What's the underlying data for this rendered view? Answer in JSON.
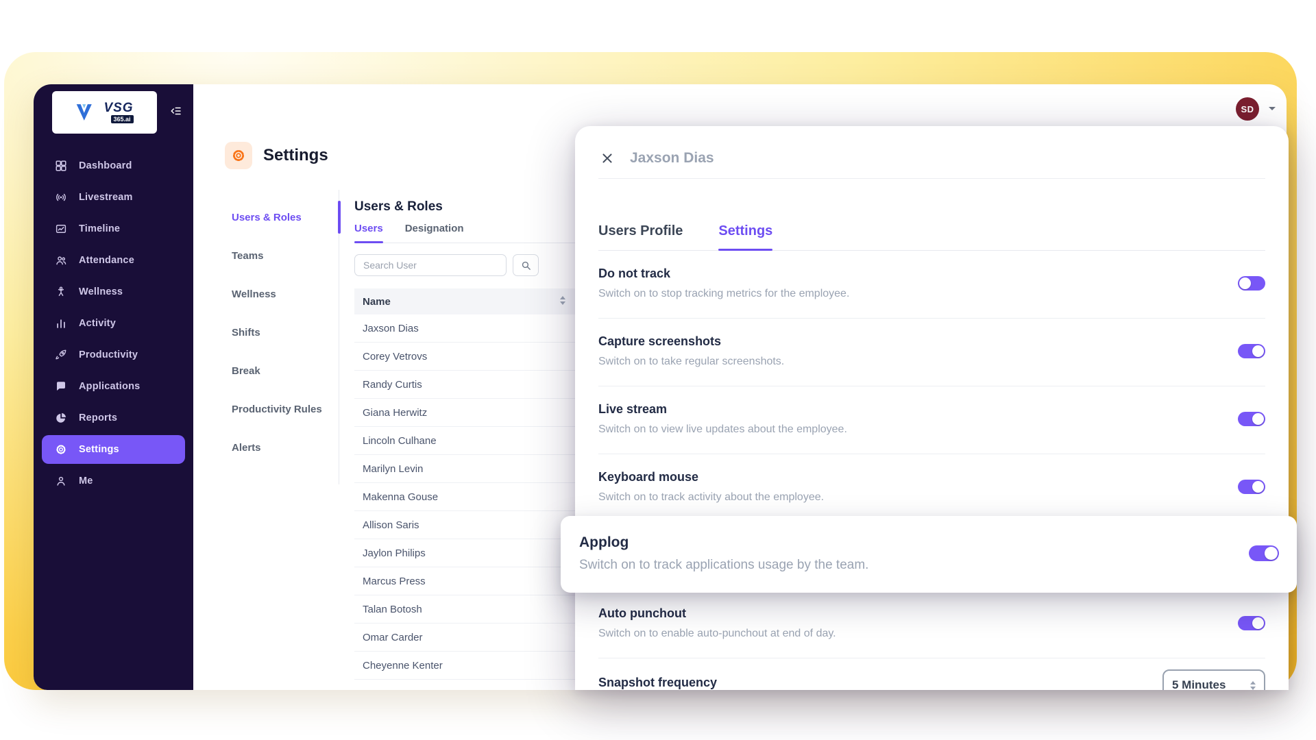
{
  "app": {
    "logo": {
      "brand": "VSG",
      "suffix": "365.ai"
    },
    "user": {
      "initials": "SD"
    }
  },
  "sidebar": {
    "items": [
      "Dashboard",
      "Livestream",
      "Timeline",
      "Attendance",
      "Wellness",
      "Activity",
      "Productivity",
      "Applications",
      "Reports",
      "Settings",
      "Me"
    ],
    "active": "Settings"
  },
  "page": {
    "title": "Settings"
  },
  "settings_nav": {
    "items": [
      "Users & Roles",
      "Teams",
      "Wellness",
      "Shifts",
      "Break",
      "Productivity Rules",
      "Alerts"
    ],
    "active": "Users & Roles"
  },
  "users_panel": {
    "heading": "Users & Roles",
    "tabs": [
      "Users",
      "Designation"
    ],
    "active_tab": "Users",
    "search_placeholder": "Search User",
    "table": {
      "name_column": "Name",
      "rows": [
        "Jaxson Dias",
        "Corey Vetrovs",
        "Randy Curtis",
        "Giana Herwitz",
        "Lincoln Culhane",
        "Marilyn Levin",
        "Makenna Gouse",
        "Allison Saris",
        "Jaylon Philips",
        "Marcus Press",
        "Talan Botosh",
        "Omar Carder",
        "Cheyenne Kenter"
      ]
    }
  },
  "drawer": {
    "title": "Jaxson Dias",
    "tabs": [
      "Users Profile",
      "Settings"
    ],
    "active_tab": "Settings",
    "settings": [
      {
        "title": "Do not track",
        "subtitle": "Switch on to stop tracking metrics for the employee.",
        "state": "off"
      },
      {
        "title": "Capture screenshots",
        "subtitle": "Switch on to take regular screenshots.",
        "state": "on"
      },
      {
        "title": "Live stream",
        "subtitle": "Switch on to view live updates about the employee.",
        "state": "on"
      },
      {
        "title": "Keyboard mouse",
        "subtitle": "Switch on to track activity about the employee.",
        "state": "on"
      },
      {
        "title": "Applog",
        "subtitle": "Switch on to track applications usage by the team.",
        "state": "on"
      },
      {
        "title": "Auto punchout",
        "subtitle": "Switch on to enable auto-punchout at end of day.",
        "state": "on"
      },
      {
        "title": "Snapshot frequency",
        "dropdown_value": "5 Minutes"
      }
    ]
  },
  "colors": {
    "accent": "#6d4df2",
    "toggle_on": "#7857f7",
    "sidebar_bg": "#190e38",
    "warning_orange": "#f97316",
    "avatar_bg": "#7b1f2f"
  }
}
